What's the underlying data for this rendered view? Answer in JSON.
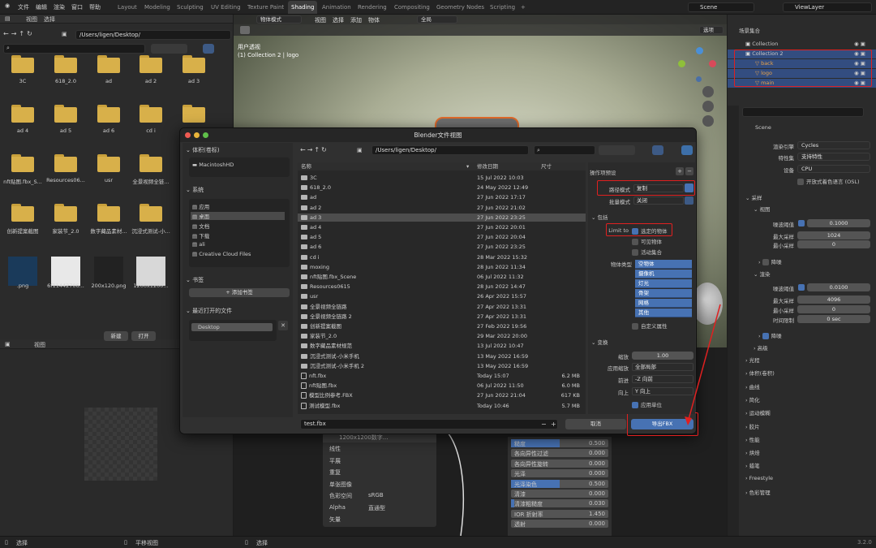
{
  "topbar": {
    "menus": [
      "文件",
      "编辑",
      "渲染",
      "窗口",
      "帮助"
    ],
    "workspaces": [
      "Layout",
      "Modeling",
      "Sculpting",
      "UV Editing",
      "Texture Paint",
      "Shading",
      "Animation",
      "Rendering",
      "Compositing",
      "Geometry Nodes",
      "Scripting"
    ],
    "active_workspace": "Shading",
    "scene": "Scene",
    "view_layer": "ViewLayer"
  },
  "filebrowser": {
    "menu": [
      "视图",
      "选择"
    ],
    "path": "/Users/ligen/Desktop/",
    "items": [
      {
        "label": "3C",
        "kind": "folder"
      },
      {
        "label": "618_2.0",
        "kind": "folder"
      },
      {
        "label": "ad",
        "kind": "folder"
      },
      {
        "label": "ad 2",
        "kind": "folder"
      },
      {
        "label": "ad 3",
        "kind": "folder"
      },
      {
        "label": "ad 4",
        "kind": "folder"
      },
      {
        "label": "ad 5",
        "kind": "folder"
      },
      {
        "label": "ad 6",
        "kind": "folder"
      },
      {
        "label": "cd i",
        "kind": "folder"
      },
      {
        "label": "",
        "kind": "folder"
      },
      {
        "label": "nft贴图.fbx_S...",
        "kind": "folder"
      },
      {
        "label": "Resources06...",
        "kind": "folder"
      },
      {
        "label": "usr",
        "kind": "folder"
      },
      {
        "label": "全景视频全链...",
        "kind": "folder"
      },
      {
        "label": "",
        "kind": "folder"
      },
      {
        "label": "创新提案截图",
        "kind": "folder"
      },
      {
        "label": "家装节_2.0",
        "kind": "folder"
      },
      {
        "label": "数字藏品素材...",
        "kind": "folder"
      },
      {
        "label": "沉浸式测试-小...",
        "kind": "folder"
      },
      {
        "label": "",
        "kind": "folder"
      },
      {
        "label": ".png",
        "kind": "image"
      },
      {
        "label": "6f11442706...",
        "kind": "image"
      },
      {
        "label": "200x120.png",
        "kind": "image"
      },
      {
        "label": "1200x1200...",
        "kind": "image"
      },
      {
        "label": "",
        "kind": "image"
      }
    ]
  },
  "image_editor": {
    "menu": [
      "视图"
    ],
    "new_label": "新建",
    "open_label": "打开"
  },
  "viewport": {
    "mode": "物体模式",
    "menu": [
      "视图",
      "选择",
      "添加",
      "物体"
    ],
    "global": "全局",
    "perspective": "用户透视",
    "collection_info": "(1) Collection 2 | logo",
    "select_btn": "选项"
  },
  "outliner": {
    "title": "场景集合",
    "items": [
      {
        "label": "Collection",
        "level": 1
      },
      {
        "label": "Collection 2",
        "level": 1,
        "selected": true
      },
      {
        "label": "back",
        "level": 2,
        "selected": true
      },
      {
        "label": "logo",
        "level": 2,
        "selected": true
      },
      {
        "label": "main",
        "level": 2,
        "selected": true
      }
    ]
  },
  "properties": {
    "scene": "Scene",
    "render_engine_label": "渲染引擎",
    "render_engine": "Cycles",
    "feature_set_label": "特性集",
    "feature_set": "支持特性",
    "device_label": "设备",
    "device": "CPU",
    "osl_label": "开放式着色语言 (OSL)",
    "sampling": "采样",
    "viewport_sec": "视图",
    "noise_threshold_label": "噪波阈值",
    "vp_noise": "0.1000",
    "max_samples_label": "最大采样",
    "vp_max": "1024",
    "min_samples_label": "最小采样",
    "vp_min": "0",
    "denoise": "降噪",
    "render_sec": "渲染",
    "r_noise": "0.0100",
    "r_max": "4096",
    "r_min": "0",
    "time_limit_label": "时间限制",
    "time_limit": "0 sec",
    "advanced": "高级",
    "sections": [
      "光程",
      "体积(卷积)",
      "曲线",
      "简化",
      "运动模糊",
      "胶片",
      "性能",
      "烘焙",
      "蜡笔",
      "Freestyle",
      "色彩管理"
    ]
  },
  "node_editor": {
    "image_name": "1200x1200数字...",
    "rows_left": [
      {
        "label": "线性",
        "value": ""
      },
      {
        "label": "平展",
        "value": ""
      },
      {
        "label": "重复",
        "value": ""
      },
      {
        "label": "单张图像",
        "value": ""
      },
      {
        "label": "色彩空间",
        "value": "sRGB"
      },
      {
        "label": "Alpha",
        "value": "直通型"
      },
      {
        "label": "矢量",
        "value": ""
      }
    ],
    "rows_right": [
      {
        "label": "糙度",
        "value": "0.500",
        "fill": 0.5
      },
      {
        "label": "各向异性过滤",
        "value": "0.000",
        "fill": 0
      },
      {
        "label": "各向异性旋转",
        "value": "0.000",
        "fill": 0
      },
      {
        "label": "光泽",
        "value": "0.000",
        "fill": 0
      },
      {
        "label": "光泽染色",
        "value": "0.500",
        "fill": 0.5
      },
      {
        "label": "清漆",
        "value": "0.000",
        "fill": 0
      },
      {
        "label": "清漆粗糙度",
        "value": "0.030",
        "fill": 0.03
      },
      {
        "label": "IOR 折射率",
        "value": "1.450",
        "fill": 0
      },
      {
        "label": "透射",
        "value": "0.000",
        "fill": 0
      }
    ]
  },
  "status": {
    "left": "选择",
    "mid": "平移视图",
    "right": "选择",
    "version": "3.2.0"
  },
  "dialog": {
    "title": "Blender文件视图",
    "path": "/Users/ligen/Desktop/",
    "volumes_title": "体积(卷标)",
    "volume": "MacintoshHD",
    "system_title": "系统",
    "system_items": [
      "应用",
      "桌面",
      "文档",
      "下载",
      "ali",
      "Creative Cloud Files"
    ],
    "bookmarks_title": "书签",
    "add_bookmark": "添加书签",
    "recent_title": "最近打开的文件",
    "recent": [
      "Desktop"
    ],
    "col_name": "名称",
    "col_date": "修改日期",
    "col_size": "尺寸",
    "files": [
      {
        "name": "3C",
        "date": "15 Jul 2022 10:03",
        "size": "",
        "type": "folder"
      },
      {
        "name": "618_2.0",
        "date": "24 May 2022 12:49",
        "size": "",
        "type": "folder"
      },
      {
        "name": "ad",
        "date": "27 Jun 2022 17:17",
        "size": "",
        "type": "folder"
      },
      {
        "name": "ad 2",
        "date": "27 Jun 2022 21:02",
        "size": "",
        "type": "folder"
      },
      {
        "name": "ad 3",
        "date": "27 Jun 2022 23:25",
        "size": "",
        "type": "folder",
        "selected": true
      },
      {
        "name": "ad 4",
        "date": "27 Jun 2022 20:01",
        "size": "",
        "type": "folder"
      },
      {
        "name": "ad 5",
        "date": "27 Jun 2022 20:04",
        "size": "",
        "type": "folder"
      },
      {
        "name": "ad 6",
        "date": "27 Jun 2022 23:25",
        "size": "",
        "type": "folder"
      },
      {
        "name": "cd i",
        "date": "28 Mar 2022 15:32",
        "size": "",
        "type": "folder"
      },
      {
        "name": "moxing",
        "date": "28 Jun 2022 11:34",
        "size": "",
        "type": "folder"
      },
      {
        "name": "nft贴图.fbx_Scene",
        "date": "06 Jul 2022 11:32",
        "size": "",
        "type": "folder"
      },
      {
        "name": "Resources0615",
        "date": "28 Jun 2022 14:47",
        "size": "",
        "type": "folder"
      },
      {
        "name": "usr",
        "date": "26 Apr 2022 15:57",
        "size": "",
        "type": "folder"
      },
      {
        "name": "全景视频全链路",
        "date": "27 Apr 2022 13:31",
        "size": "",
        "type": "folder"
      },
      {
        "name": "全景视频全链路 2",
        "date": "27 Apr 2022 13:31",
        "size": "",
        "type": "folder"
      },
      {
        "name": "创新提案截图",
        "date": "27 Feb 2022 19:56",
        "size": "",
        "type": "folder"
      },
      {
        "name": "家装节_2.0",
        "date": "29 Mar 2022 20:00",
        "size": "",
        "type": "folder"
      },
      {
        "name": "数字藏品素材规范",
        "date": "13 Jul 2022 10:47",
        "size": "",
        "type": "folder"
      },
      {
        "name": "沉浸式测试-小米手机",
        "date": "13 May 2022 16:59",
        "size": "",
        "type": "folder"
      },
      {
        "name": "沉浸式测试-小米手机 2",
        "date": "13 May 2022 16:59",
        "size": "",
        "type": "folder"
      },
      {
        "name": "nft.fbx",
        "date": "Today 15:07",
        "size": "6.2 MB",
        "type": "file"
      },
      {
        "name": "nft贴图.fbx",
        "date": "06 Jul 2022 11:50",
        "size": "6.0 MB",
        "type": "file"
      },
      {
        "name": "模型比例参考.FBX",
        "date": "27 Jun 2022 21:04",
        "size": "617 KB",
        "type": "file"
      },
      {
        "name": "测试模型.fbx",
        "date": "Today 10:46",
        "size": "5.7 MB",
        "type": "file"
      }
    ],
    "filename": "test.fbx",
    "cancel": "取消",
    "export": "导出FBX",
    "operator_presets": "操作项预设",
    "path_mode_label": "路径模式",
    "path_mode": "复制",
    "batch_mode_label": "批量模式",
    "batch_mode": "关闭",
    "include_title": "包括",
    "limit_to_label": "Limit to",
    "selected_objects": "选定的物体",
    "visible_objects": "可见物体",
    "active_collection": "活动集合",
    "object_types_label": "物体类型",
    "object_types": [
      "空物体",
      "摄像机",
      "灯光",
      "骨架",
      "网格",
      "其他"
    ],
    "custom_props": "自定义属性",
    "transform_title": "变换",
    "scale_label": "缩放",
    "scale": "1.00",
    "apply_scale_label": "应用缩放",
    "apply_scale": "全部局部",
    "forward_label": "前进",
    "forward": "-Z 向前",
    "up_label": "向上",
    "up": "Y 向上",
    "apply_unit": "应用单位"
  }
}
